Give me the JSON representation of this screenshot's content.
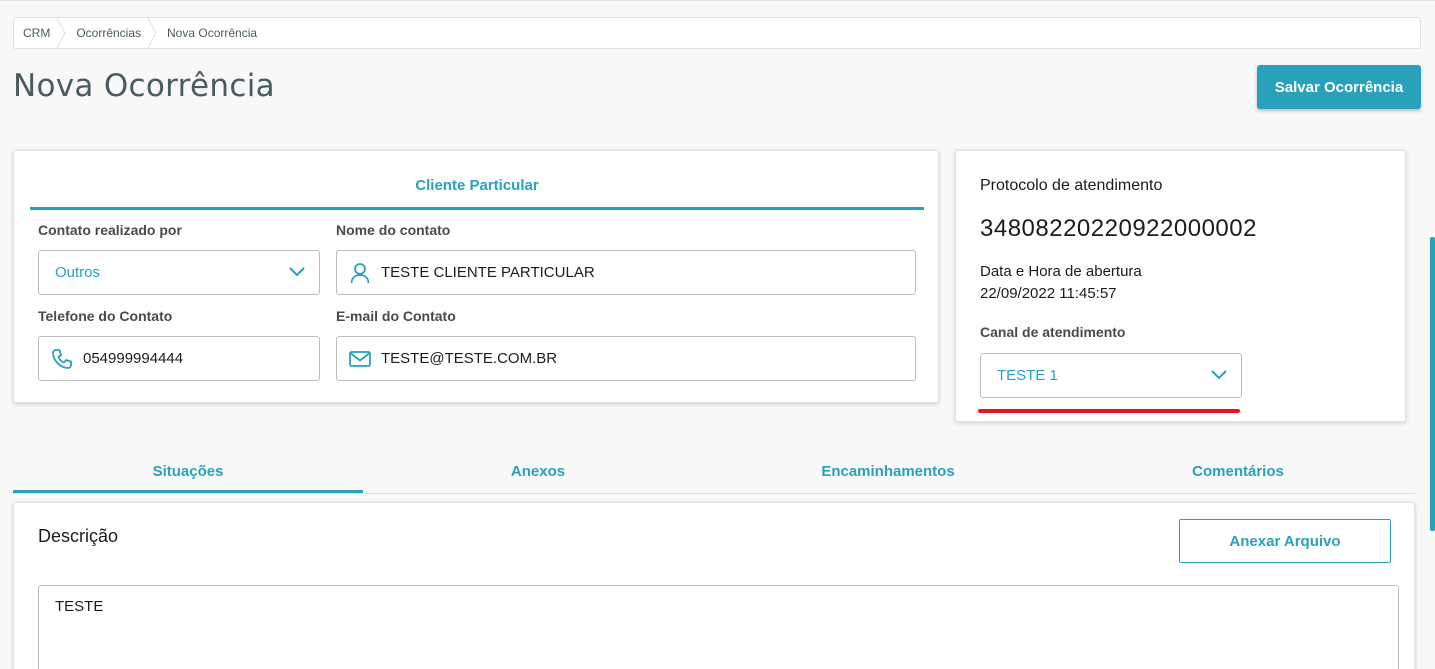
{
  "breadcrumb": [
    "CRM",
    "Ocorrências",
    "Nova Ocorrência"
  ],
  "page": {
    "title": "Nova Ocorrência",
    "save_label": "Salvar Ocorrência"
  },
  "client": {
    "tab_label": "Cliente Particular",
    "contato_label": "Contato realizado por",
    "contato_value": "Outros",
    "nome_label": "Nome do contato",
    "nome_value": "TESTE CLIENTE PARTICULAR",
    "telefone_label": "Telefone do Contato",
    "telefone_value": "054999994444",
    "email_label": "E-mail do Contato",
    "email_value": "TESTE@TESTE.COM.BR"
  },
  "protocol": {
    "label": "Protocolo de atendimento",
    "number": "34808220220922000002",
    "datetime_label": "Data e Hora de abertura",
    "datetime_value": "22/09/2022 11:45:57",
    "canal_label": "Canal de atendimento",
    "canal_value": "TESTE 1"
  },
  "tabs": [
    "Situações",
    "Anexos",
    "Encaminhamentos",
    "Comentários"
  ],
  "description": {
    "label": "Descrição",
    "attach_label": "Anexar Arquivo",
    "text": "TESTE"
  },
  "colors": {
    "accent": "#29a1bb",
    "highlight": "#e5161e"
  },
  "icons": {
    "chevron": "chevron-down-icon",
    "user": "user-icon",
    "phone": "phone-icon",
    "mail": "mail-icon",
    "crumb_separator": "chevron-right-icon"
  }
}
